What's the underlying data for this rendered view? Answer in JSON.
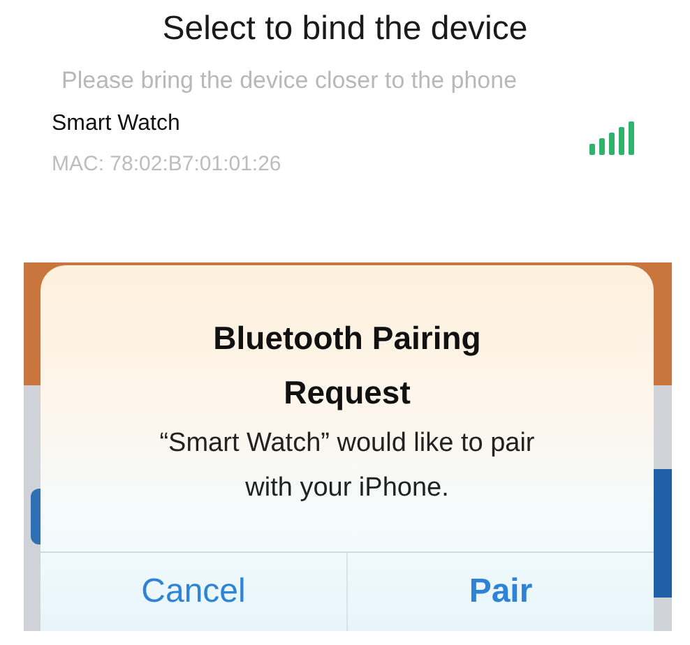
{
  "screen": {
    "title": "Select to bind the device",
    "hint": "Please bring the device closer to the phone"
  },
  "devices": [
    {
      "name": "Smart Watch",
      "mac": "MAC: 78:02:B7:01:01:26"
    }
  ],
  "alert": {
    "title": "Bluetooth Pairing Request",
    "message": "“Smart Watch” would like to pair with your iPhone.",
    "buttons": [
      {
        "label": "Cancel",
        "kind": "cancel"
      },
      {
        "label": "Pair",
        "kind": "default"
      }
    ]
  }
}
